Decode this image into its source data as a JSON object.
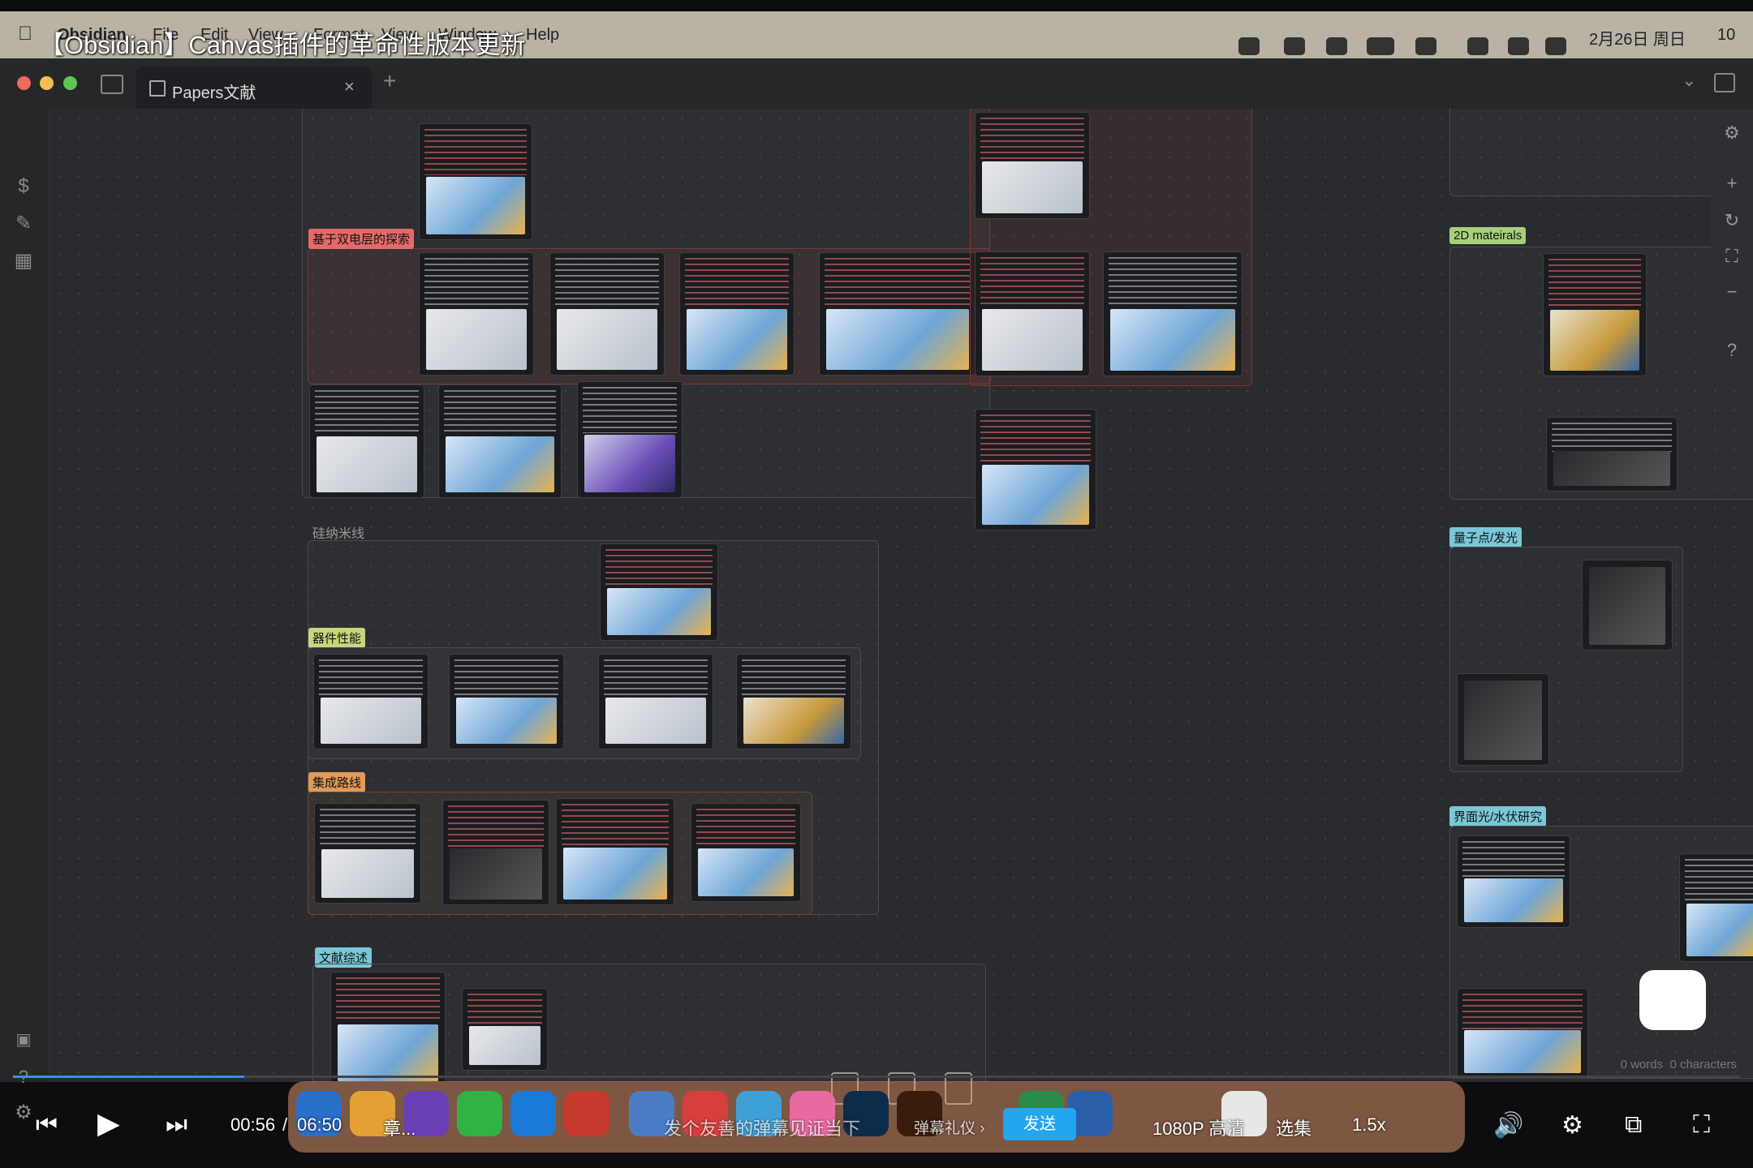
{
  "menubar": {
    "app_name": "Obsidian",
    "menus": [
      "File",
      "Edit",
      "View",
      "Format",
      "View",
      "Window",
      "Help"
    ],
    "date_time": "2月26日 周日",
    "hour_fragment": "10"
  },
  "video": {
    "title": "【Obsidian】Canvas插件的革命性版本更新",
    "current_time": "00:56",
    "separator": "/",
    "total_time": "06:50",
    "danmaku_placeholder": "发个友善的弹幕见证当下",
    "gift_label": "弹幕礼仪 ›",
    "send_label": "发送",
    "quality_label": "1080P 高清",
    "episodes_label": "选集",
    "speed_label": "1.5x",
    "chapter_label": "章..."
  },
  "tab": {
    "label": "Papers文献"
  },
  "canvas": {
    "groups": {
      "double_layer": "基于双电层的探索",
      "silicon_nanowire": "硅纳米线",
      "device_performance": "器件性能",
      "integration": "集成路线",
      "review": "文献综述",
      "mat2d": "2D mateirals",
      "quantum_dot": "量子点/发光",
      "interface": "界面光/水伏研究"
    },
    "label_colors": {
      "double_layer": "#e46a6a",
      "device_performance": "#c7d77a",
      "integration": "#e09a5a",
      "review": "#7ac7d7",
      "mat2d": "#a6d07a",
      "quantum_dot": "#7ac7d7",
      "interface": "#7ac7d7"
    }
  },
  "status": {
    "words": "0 words",
    "characters": "0 characters"
  },
  "icons": [
    "apple-icon",
    "sidebar-toggle-icon",
    "canvas-icon",
    "close-icon",
    "plus-icon",
    "chevron-down-icon",
    "right-sidebar-icon",
    "dollar-icon",
    "pen-icon",
    "grid-icon",
    "vault-icon",
    "help-icon",
    "settings-icon",
    "zoom-in-icon",
    "zoom-out-icon",
    "reset-icon",
    "fit-icon",
    "card-icon",
    "note-icon",
    "media-icon"
  ]
}
